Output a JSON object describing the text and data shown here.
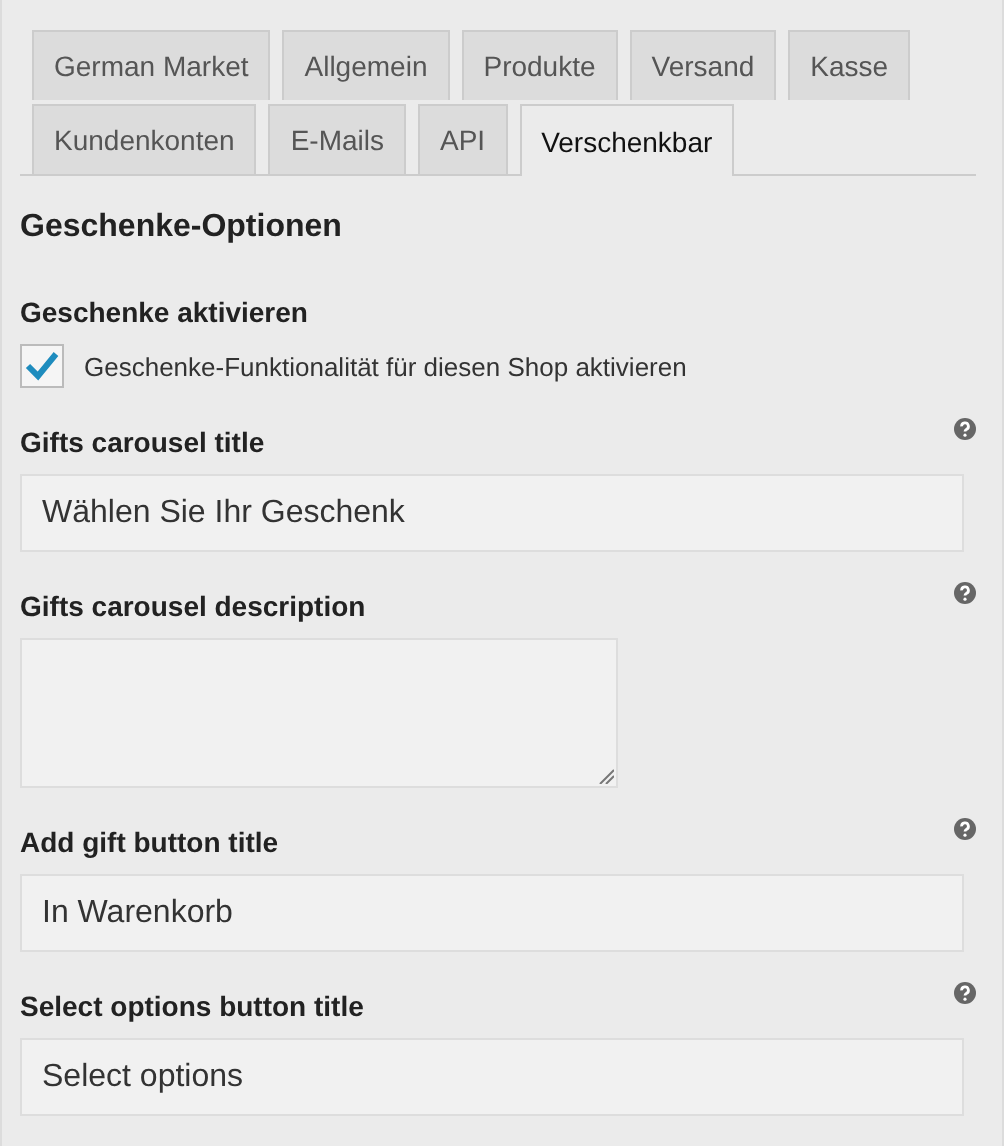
{
  "tabs": [
    {
      "label": "German Market",
      "selected": false
    },
    {
      "label": "Allgemein",
      "selected": false
    },
    {
      "label": "Produkte",
      "selected": false
    },
    {
      "label": "Versand",
      "selected": false
    },
    {
      "label": "Kasse",
      "selected": false
    },
    {
      "label": "Kundenkonten",
      "selected": false
    },
    {
      "label": "E-Mails",
      "selected": false
    },
    {
      "label": "API",
      "selected": false
    },
    {
      "label": "Verschenkbar",
      "selected": true
    }
  ],
  "section_title": "Geschenke-Optionen",
  "fields": [
    {
      "kind": "checkbox",
      "label": "Geschenke aktivieren",
      "option": "Geschenke-Funktionalität für diesen Shop aktivieren",
      "checked": true
    },
    {
      "kind": "text",
      "label": "Gifts carousel title",
      "value": "Wählen Sie Ihr Geschenk",
      "help": true
    },
    {
      "kind": "textarea",
      "label": "Gifts carousel description",
      "help": true
    },
    {
      "kind": "text",
      "label": "Add gift button title",
      "value": "In Warenkorb",
      "help": true
    },
    {
      "kind": "text",
      "label": "Select options button title",
      "value": "Select options",
      "help": true
    }
  ]
}
